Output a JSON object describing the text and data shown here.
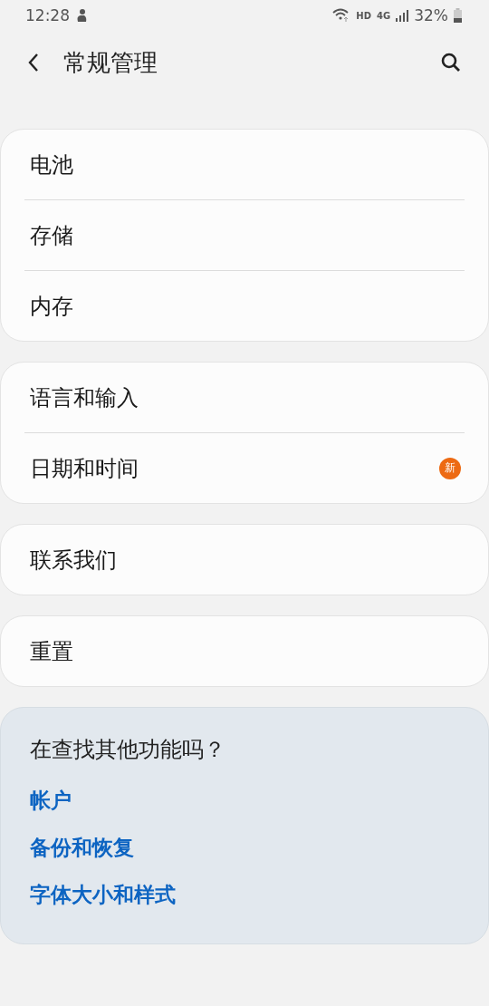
{
  "status_bar": {
    "time": "12:28",
    "network_label": "HD",
    "network_type": "4G",
    "battery": "32%"
  },
  "header": {
    "title": "常规管理"
  },
  "groups": [
    {
      "items": [
        {
          "label": "电池"
        },
        {
          "label": "存储"
        },
        {
          "label": "内存"
        }
      ]
    },
    {
      "items": [
        {
          "label": "语言和输入"
        },
        {
          "label": "日期和时间",
          "badge": "新"
        }
      ]
    },
    {
      "items": [
        {
          "label": "联系我们"
        }
      ]
    },
    {
      "items": [
        {
          "label": "重置"
        }
      ]
    }
  ],
  "suggestions": {
    "title": "在查找其他功能吗？",
    "links": [
      "帐户",
      "备份和恢复",
      "字体大小和样式"
    ]
  }
}
